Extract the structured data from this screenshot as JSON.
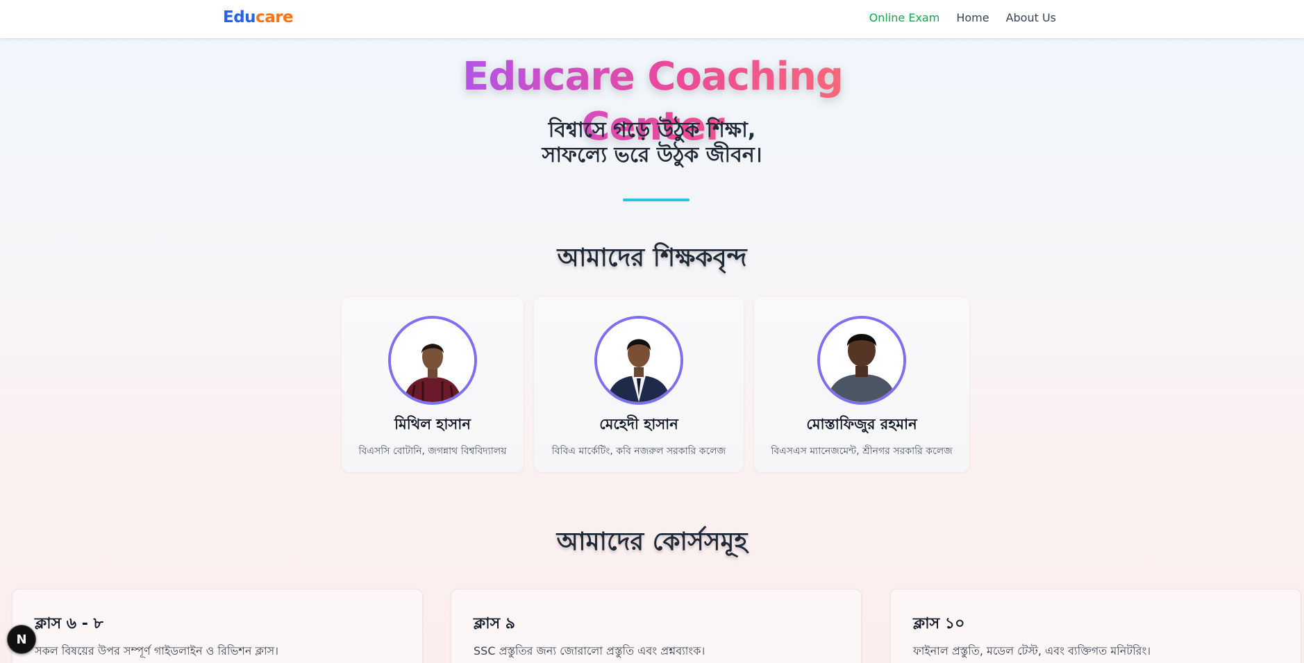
{
  "nav": {
    "logo_part1": "Edu",
    "logo_part2": "care",
    "links": [
      "Online Exam",
      "Home",
      "About Us"
    ]
  },
  "hero": {
    "title": "Educare Coaching Center",
    "tagline_line1": "বিশ্বাসে গড়ে উঠুক শিক্ষা,",
    "tagline_line2": "সাফল্যে ভরে উঠুক জীবন।"
  },
  "teachers": {
    "heading": "আমাদের শিক্ষকবৃন্দ",
    "items": [
      {
        "name": "মিথিল হাসান",
        "degree": "বিএসসি বোটানি, জগন্নাথ বিশ্ববিদ্যালয়"
      },
      {
        "name": "মেহেদী হাসান",
        "degree": "বিবিএ মার্কেটিং, কবি নজরুল সরকারি কলেজ"
      },
      {
        "name": "মোস্তাফিজুর রহমান",
        "degree": "বিএসএস ম্যানেজমেন্ট, শ্রীনগর সরকারি কলেজ"
      }
    ]
  },
  "courses": {
    "heading": "আমাদের কোর্সসমূহ",
    "items": [
      {
        "title": "ক্লাস ৬ - ৮",
        "desc": "সকল বিষয়ের উপর সম্পূর্ণ গাইডলাইন ও রিভিশন ক্লাস।"
      },
      {
        "title": "ক্লাস ৯",
        "desc": "SSC প্রস্তুতির জন্য জোরালো প্রস্তুতি এবং প্রশ্নব্যাংক।"
      },
      {
        "title": "ক্লাস ১০",
        "desc": "ফাইনাল প্রস্তুতি, মডেল টেস্ট, এবং ব্যক্তিগত মনিটরিং।"
      }
    ]
  },
  "badge": {
    "letter": "N"
  },
  "colors": {
    "logo_edu": "#2563eb",
    "logo_care": "#f97316",
    "nav_active": "#16a34a",
    "divider": "#22c3e6",
    "avatar_ring": "#7c6ff0"
  }
}
